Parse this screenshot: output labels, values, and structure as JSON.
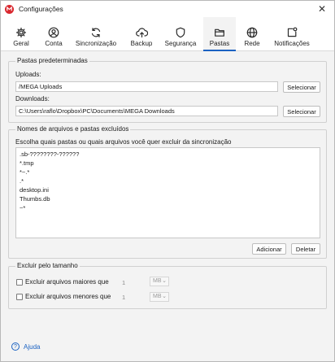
{
  "window": {
    "title": "Configurações",
    "close_glyph": "✕"
  },
  "tabs": [
    {
      "label": "Geral",
      "icon": "gear-icon"
    },
    {
      "label": "Conta",
      "icon": "account-icon"
    },
    {
      "label": "Sincronização",
      "icon": "sync-icon"
    },
    {
      "label": "Backup",
      "icon": "cloud-upload-icon"
    },
    {
      "label": "Segurança",
      "icon": "shield-icon"
    },
    {
      "label": "Pastas",
      "icon": "folder-icon",
      "active": true
    },
    {
      "label": "Rede",
      "icon": "globe-icon"
    },
    {
      "label": "Notificações",
      "icon": "notification-icon"
    }
  ],
  "default_folders": {
    "title": "Pastas predeterminadas",
    "uploads_label": "Uploads:",
    "uploads_value": "/MEGA Uploads",
    "downloads_label": "Downloads:",
    "downloads_value": "C:\\Users\\raflo\\Dropbox\\PC\\Documents\\MEGA Downloads",
    "select_label": "Selecionar"
  },
  "excluded": {
    "title": "Nomes de arquivos e pastas excluídos",
    "instruction": "Escolha quais pastas ou quais arquivos você quer excluir da sincronização",
    "items": [
      ".sb-????????-??????",
      "*.tmp",
      "*~.*",
      ".*",
      "desktop.ini",
      "Thumbs.db",
      "~*"
    ],
    "add_label": "Adicionar",
    "delete_label": "Deletar"
  },
  "size_exclusion": {
    "title": "Excluir pelo tamanho",
    "larger_label": "Excluir arquivos maiores que",
    "larger_value": "1",
    "larger_unit": "MB",
    "smaller_label": "Excluir arquivos menores que",
    "smaller_value": "1",
    "smaller_unit": "MB",
    "chevron": "⌄"
  },
  "help": {
    "label": "Ajuda",
    "glyph": "?"
  },
  "colors": {
    "accent": "#1b62c2",
    "brand": "#d9272e",
    "background": "#f3f3f3"
  }
}
